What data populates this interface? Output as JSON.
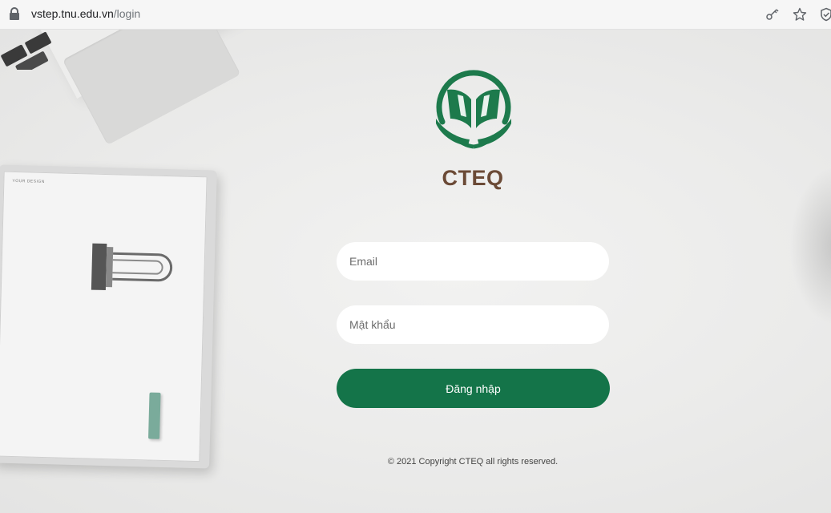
{
  "browser": {
    "url_domain": "vstep.tnu.edu.vn",
    "url_path": "/login",
    "icons": [
      "lock-icon",
      "key-icon",
      "star-icon",
      "shield-icon"
    ]
  },
  "background": {
    "paper_label": "YOUR DESIGN"
  },
  "login": {
    "brand": "CTEQ",
    "email_placeholder": "Email",
    "password_placeholder": "Mật khẩu",
    "submit_label": "Đăng nhập",
    "copyright": "© 2021 Copyright CTEQ all rights reserved."
  },
  "colors": {
    "primary_green": "#147449",
    "brand_brown": "#6b4a36",
    "logo_green": "#1d7a4c"
  }
}
